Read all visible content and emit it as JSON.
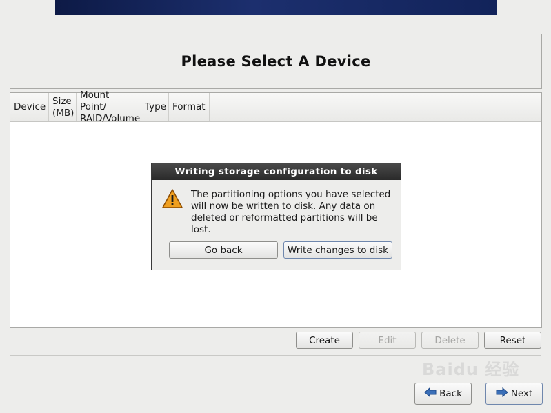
{
  "page": {
    "title": "Please Select A Device"
  },
  "table": {
    "headers": [
      {
        "line1": "Device",
        "line2": ""
      },
      {
        "line1": "Size",
        "line2": "(MB)"
      },
      {
        "line1": "Mount Point/",
        "line2": "RAID/Volume"
      },
      {
        "line1": "Type",
        "line2": ""
      },
      {
        "line1": "Format",
        "line2": ""
      }
    ]
  },
  "dialog": {
    "title": "Writing storage configuration to disk",
    "message": "The partitioning options you have selected will now be written to disk.  Any data on deleted or reformatted partitions will be lost.",
    "icon": "warning-icon",
    "buttons": {
      "go_back": "Go back",
      "write_changes": "Write changes to disk"
    }
  },
  "actions": {
    "create": "Create",
    "edit": "Edit",
    "delete": "Delete",
    "reset": "Reset"
  },
  "nav": {
    "back": "Back",
    "next": "Next"
  },
  "watermark": "Baidu 经验",
  "colors": {
    "banner": "#12235a",
    "dialog_title_bg": "#2f2f2f",
    "warning": "#f0a020"
  }
}
